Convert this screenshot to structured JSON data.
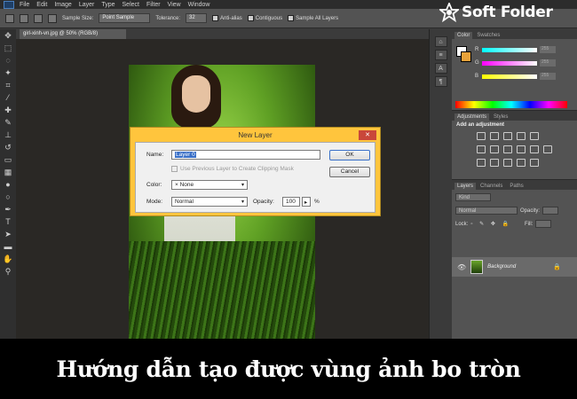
{
  "menu": [
    "File",
    "Edit",
    "Image",
    "Layer",
    "Type",
    "Select",
    "Filter",
    "View",
    "Window"
  ],
  "options_bar": {
    "sample_size_label": "Sample Size:",
    "sample_size_value": "Point Sample",
    "tolerance_label": "Tolerance:",
    "tolerance_value": "32",
    "anti_alias": "Anti-alias",
    "contiguous": "Contiguous",
    "sample_all_layers": "Sample All Layers"
  },
  "document_tab": "girl-xinh-vn.jpg @ 50% (RGB/8)",
  "brand": "Soft Folder",
  "color_panel": {
    "tabs": [
      "Color",
      "Swatches"
    ],
    "sliders": [
      {
        "key": "R",
        "value": "255"
      },
      {
        "key": "G",
        "value": "255"
      },
      {
        "key": "B",
        "value": "255"
      }
    ]
  },
  "adjustments_panel": {
    "tabs": [
      "Adjustments",
      "Styles"
    ],
    "title": "Add an adjustment"
  },
  "layers_panel": {
    "tabs": [
      "Layers",
      "Channels",
      "Paths"
    ],
    "kind": "Kind",
    "blend_mode": "Normal",
    "opacity_label": "Opacity:",
    "lock_label": "Lock:",
    "fill_label": "Fill:",
    "layer_name": "Background"
  },
  "dialog": {
    "title": "New Layer",
    "name_label": "Name:",
    "name_value": "Layer 0",
    "clipping_mask_label": "Use Previous Layer to Create Clipping Mask",
    "color_label": "Color:",
    "color_value": "None",
    "mode_label": "Mode:",
    "mode_value": "Normal",
    "opacity_label": "Opacity:",
    "opacity_value": "100",
    "percent": "%",
    "ok_label": "OK",
    "cancel_label": "Cancel",
    "close_icon": "close-icon"
  },
  "caption": "Hướng dẫn tạo được vùng ảnh bo tròn",
  "colors": {
    "dialog_border": "#ffc53d",
    "close_button": "#c9473a",
    "selection": "#3a70c8",
    "background_swatch": "#e8a23a"
  }
}
